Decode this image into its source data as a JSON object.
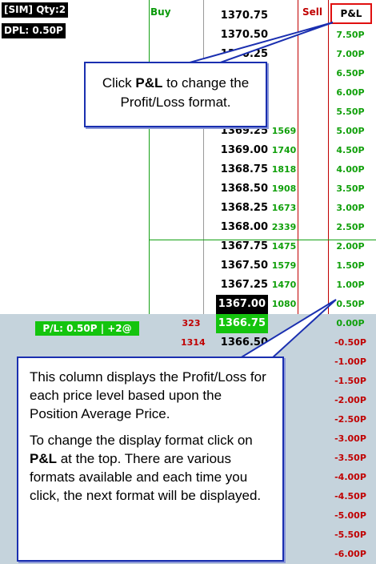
{
  "account": {
    "label": "[SIM]  Qty:2",
    "dpl": "DPL: 0.50P"
  },
  "headers": {
    "buy": "Buy",
    "sell": "Sell",
    "pl": "P&L"
  },
  "position_badge": "P/L: 0.50P | +2@",
  "rows": [
    {
      "price": "1370.75",
      "vol": "",
      "ask": "",
      "pnl": "",
      "style": ""
    },
    {
      "price": "1370.50",
      "vol": "",
      "ask": "",
      "pnl": "7.50P",
      "style": ""
    },
    {
      "price": "1370.25",
      "vol": "",
      "ask": "",
      "pnl": "7.00P",
      "style": ""
    },
    {
      "price": "",
      "vol": "",
      "ask": "",
      "pnl": "6.50P",
      "style": ""
    },
    {
      "price": "",
      "vol": "",
      "ask": "",
      "pnl": "6.00P",
      "style": ""
    },
    {
      "price": "",
      "vol": "",
      "ask": "",
      "pnl": "5.50P",
      "style": ""
    },
    {
      "price": "1369.25",
      "vol": "1569",
      "ask": "",
      "pnl": "5.00P",
      "style": ""
    },
    {
      "price": "1369.00",
      "vol": "1740",
      "ask": "",
      "pnl": "4.50P",
      "style": ""
    },
    {
      "price": "1368.75",
      "vol": "1818",
      "ask": "",
      "pnl": "4.00P",
      "style": ""
    },
    {
      "price": "1368.50",
      "vol": "1908",
      "ask": "",
      "pnl": "3.50P",
      "style": ""
    },
    {
      "price": "1368.25",
      "vol": "1673",
      "ask": "",
      "pnl": "3.00P",
      "style": ""
    },
    {
      "price": "1368.00",
      "vol": "2339",
      "ask": "",
      "pnl": "2.50P",
      "style": ""
    },
    {
      "price": "1367.75",
      "vol": "1475",
      "ask": "",
      "pnl": "2.00P",
      "style": ""
    },
    {
      "price": "1367.50",
      "vol": "1579",
      "ask": "",
      "pnl": "1.50P",
      "style": ""
    },
    {
      "price": "1367.25",
      "vol": "1470",
      "ask": "",
      "pnl": "1.00P",
      "style": ""
    },
    {
      "price": "1367.00",
      "vol": "1080",
      "ask": "",
      "pnl": "0.50P",
      "style": "cur"
    },
    {
      "price": "1366.75",
      "vol": "",
      "ask": "323",
      "pnl": "0.00P",
      "style": "avg"
    },
    {
      "price": "1366.50",
      "vol": "",
      "ask": "1314",
      "pnl": "-0.50P",
      "style": ""
    },
    {
      "price": "",
      "vol": "",
      "ask": "",
      "pnl": "-1.00P",
      "style": ""
    },
    {
      "price": "",
      "vol": "",
      "ask": "",
      "pnl": "-1.50P",
      "style": ""
    },
    {
      "price": "",
      "vol": "",
      "ask": "",
      "pnl": "-2.00P",
      "style": ""
    },
    {
      "price": "",
      "vol": "",
      "ask": "",
      "pnl": "-2.50P",
      "style": ""
    },
    {
      "price": "",
      "vol": "",
      "ask": "",
      "pnl": "-3.00P",
      "style": ""
    },
    {
      "price": "",
      "vol": "",
      "ask": "",
      "pnl": "-3.50P",
      "style": ""
    },
    {
      "price": "",
      "vol": "",
      "ask": "",
      "pnl": "-4.00P",
      "style": ""
    },
    {
      "price": "",
      "vol": "",
      "ask": "",
      "pnl": "-4.50P",
      "style": ""
    },
    {
      "price": "",
      "vol": "",
      "ask": "",
      "pnl": "-5.00P",
      "style": ""
    },
    {
      "price": "",
      "vol": "",
      "ask": "",
      "pnl": "-5.50P",
      "style": ""
    },
    {
      "price": "",
      "vol": "",
      "ask": "",
      "pnl": "-6.00P",
      "style": ""
    }
  ],
  "callouts": {
    "top": {
      "pre": "Click ",
      "bold": "P&L",
      "post": " to change the Profit/Loss format."
    },
    "bottom": {
      "para1": "This column displays the Profit/Loss for each price level based upon the Position Average Price.",
      "para2_pre": "To change the display format click on ",
      "para2_bold": "P&L",
      "para2_post": " at the top. There are various formats available and each time you click, the next format will be displayed."
    }
  },
  "colors": {
    "buy": "#0a9a0a",
    "sell": "#c00000",
    "pnl_pos": "#11a00b",
    "pnl_neg": "#c00000",
    "callout_border": "#1a2fb0",
    "position_bg": "#c5d3dc"
  }
}
